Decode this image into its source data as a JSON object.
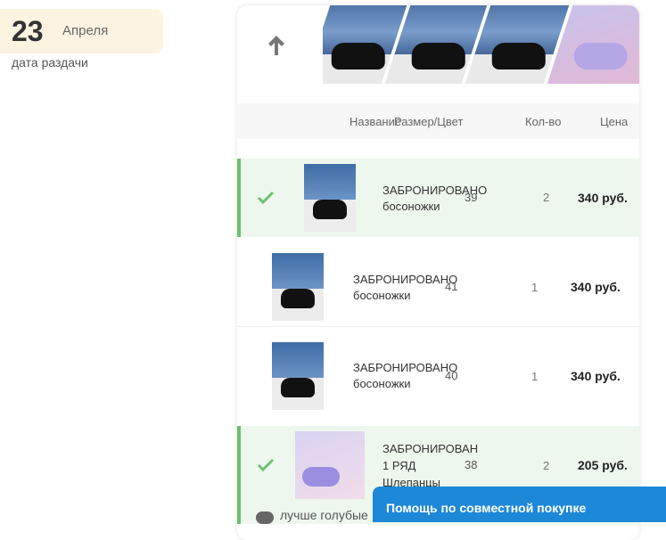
{
  "date": {
    "day": "23",
    "month": "Апреля",
    "caption": "дата раздачи"
  },
  "table": {
    "headers": {
      "name": "Название",
      "size": "Размер/Цвет",
      "qty": "Кол-во",
      "price": "Цена"
    },
    "rows": [
      {
        "checked": true,
        "name_line1": "ЗАБРОНИРОВАНО",
        "name_line2": "босоножки",
        "size": "39",
        "qty": "2",
        "price": "340 руб."
      },
      {
        "checked": false,
        "name_line1": "ЗАБРОНИРОВАНО",
        "name_line2": "босоножки",
        "size": "41",
        "qty": "1",
        "price": "340 руб."
      },
      {
        "checked": false,
        "name_line1": "ЗАБРОНИРОВАНО",
        "name_line2": "босоножки",
        "size": "40",
        "qty": "1",
        "price": "340 руб."
      },
      {
        "checked": true,
        "name_line1": "ЗАБРОНИРОВАН",
        "name_line2": "1 РЯД",
        "name_line3": "Шлепанцы",
        "size": "38",
        "qty": "2",
        "price": "205 руб."
      }
    ]
  },
  "comment_preview": "лучше голубые",
  "help_bar": {
    "label": "Помощь по совместной покупке"
  },
  "icons": {
    "up": "arrow-up-icon",
    "check": "check-icon",
    "chat": "chat-bubble-icon"
  },
  "colors": {
    "accent_green": "#6cc070",
    "help_blue": "#1e88d8",
    "date_bg": "#fdf3e1"
  }
}
